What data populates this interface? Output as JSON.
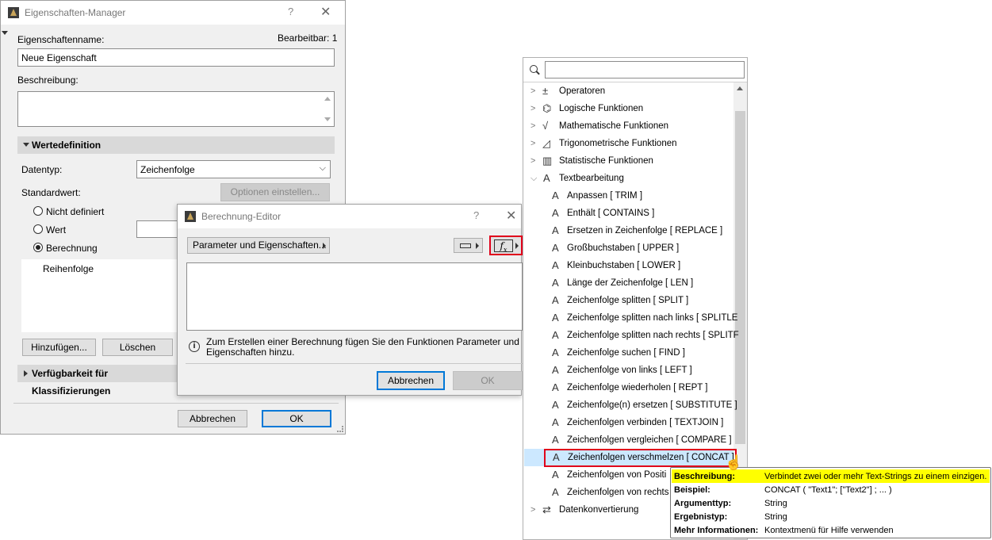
{
  "manager": {
    "title": "Eigenschaften-Manager",
    "help": "?",
    "close": "✕",
    "name_label": "Eigenschaftenname:",
    "editable": "Bearbeitbar: 1",
    "name_value": "Neue Eigenschaft",
    "desc_label": "Beschreibung:",
    "section_values": "Wertedefinition",
    "datatype_label": "Datentyp:",
    "datatype_value": "Zeichenfolge",
    "default_label": "Standardwert:",
    "options_button": "Optionen einstellen...",
    "radio_undefined": "Nicht definiert",
    "radio_value": "Wert",
    "radio_calc": "Berechnung",
    "order_header": "Reihenfolge",
    "add_button": "Hinzufügen...",
    "delete_button": "Löschen",
    "section_availability": "Verfügbarkeit für Klassifizierungen",
    "cancel_button": "Abbrechen",
    "ok_button": "OK"
  },
  "editor": {
    "title": "Berechnung-Editor",
    "help": "?",
    "close": "✕",
    "params_button": "Parameter und Eigenschaften...",
    "hint": "Zum Erstellen einer Berechnung fügen Sie den Funktionen Parameter und Eigenschaften hinzu.",
    "cancel_button": "Abbrechen",
    "ok_button": "OK"
  },
  "functions": {
    "search_placeholder": "",
    "categories_top": [
      {
        "label": "Operatoren",
        "icon": "±"
      },
      {
        "label": "Logische Funktionen",
        "icon": "⌬"
      },
      {
        "label": "Mathematische Funktionen",
        "icon": "√"
      },
      {
        "label": "Trigonometrische Funktionen",
        "icon": "◿"
      },
      {
        "label": "Statistische Funktionen",
        "icon": "▥"
      }
    ],
    "expanded_category": "Textbearbeitung",
    "items": [
      "Anpassen [ TRIM ]",
      "Enthält [ CONTAINS ]",
      "Ersetzen in Zeichenfolge [ REPLACE ]",
      "Großbuchstaben [ UPPER ]",
      "Kleinbuchstaben [ LOWER ]",
      "Länge der Zeichenfolge [ LEN ]",
      "Zeichenfolge splitten [ SPLIT ]",
      "Zeichenfolge splitten nach links [ SPLITLE",
      "Zeichenfolge splitten nach rechts [ SPLITF",
      "Zeichenfolge suchen [ FIND ]",
      "Zeichenfolge von links [ LEFT ]",
      "Zeichenfolge wiederholen [ REPT ]",
      "Zeichenfolge(n) ersetzen [ SUBSTITUTE ]",
      "Zeichenfolgen verbinden [ TEXTJOIN ]",
      "Zeichenfolgen vergleichen [ COMPARE ]",
      "Zeichenfolgen verschmelzen [ CONCAT ]",
      "Zeichenfolgen von Positi",
      "Zeichenfolgen von rechts"
    ],
    "last_category": "Datenkonvertierung"
  },
  "tooltip": {
    "desc_key": "Beschreibung:",
    "desc_val": "Verbindet zwei oder mehr Text-Strings zu einem einzigen.",
    "example_key": "Beispiel:",
    "example_val": "CONCAT ( \"Text1\"; [\"Text2\"] ; ... )",
    "argtype_key": "Argumenttyp:",
    "argtype_val": "String",
    "result_key": "Ergebnistyp:",
    "result_val": "String",
    "more_key": "Mehr Informationen:",
    "more_val": "Kontextmenü für Hilfe verwenden"
  },
  "colors": {
    "accent": "#0078d7",
    "highlight_red": "#e0001b",
    "tooltip_yellow": "#ffff00",
    "selected_row": "#cce8ff"
  }
}
